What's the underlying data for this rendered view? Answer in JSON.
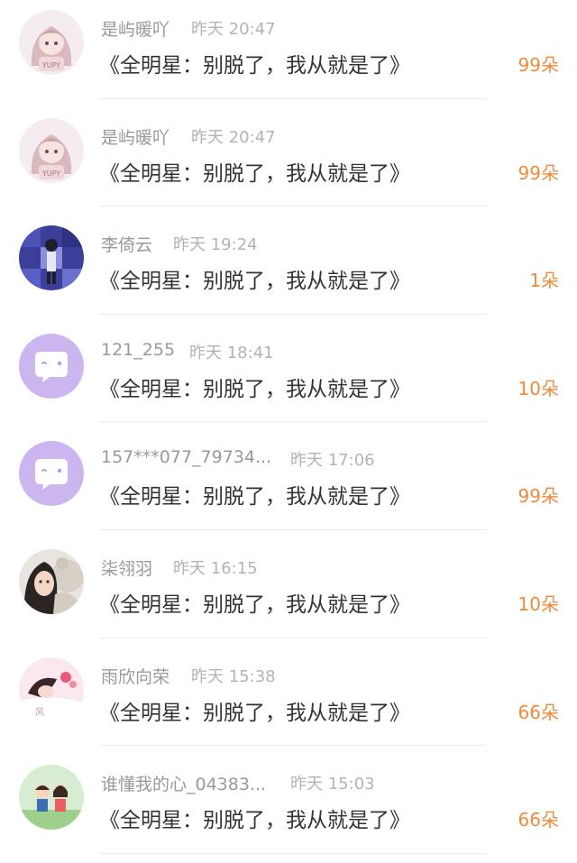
{
  "comments": [
    {
      "avatar": "anime-girl-avatar",
      "username": "是屿暖吖",
      "time": "昨天 20:47",
      "title": "《全明星：别脱了，我从就是了》",
      "flowers": "99朵"
    },
    {
      "avatar": "anime-girl-avatar",
      "username": "是屿暖吖",
      "time": "昨天 20:47",
      "title": "《全明星：别脱了，我从就是了》",
      "flowers": "99朵"
    },
    {
      "avatar": "pixel-photo-avatar",
      "username": "李倚云",
      "time": "昨天 19:24",
      "title": "《全明星：别脱了，我从就是了》",
      "flowers": "1朵"
    },
    {
      "avatar": "default-chat-avatar",
      "username": "121_255",
      "time": "昨天 18:41",
      "title": "《全明星：别脱了，我从就是了》",
      "flowers": "10朵"
    },
    {
      "avatar": "default-chat-avatar",
      "username": "157***077_79734...",
      "time": "昨天 17:06",
      "title": "《全明星：别脱了，我从就是了》",
      "flowers": "99朵"
    },
    {
      "avatar": "girl-with-bear-avatar",
      "username": "柒翎羽",
      "time": "昨天 16:15",
      "title": "《全明星：别脱了，我从就是了》",
      "flowers": "10朵"
    },
    {
      "avatar": "sleeping-girl-avatar",
      "username": "雨欣向荣",
      "time": "昨天 15:38",
      "title": "《全明星：别脱了，我从就是了》",
      "flowers": "66朵"
    },
    {
      "avatar": "cartoon-couple-avatar",
      "username": "谁懂我的心_04383...",
      "time": "昨天 15:03",
      "title": "《全明星：别脱了，我从就是了》",
      "flowers": "66朵"
    }
  ],
  "colors": {
    "flower_accent": "#f08a3c",
    "default_avatar_bg": "#cbb6f0"
  }
}
